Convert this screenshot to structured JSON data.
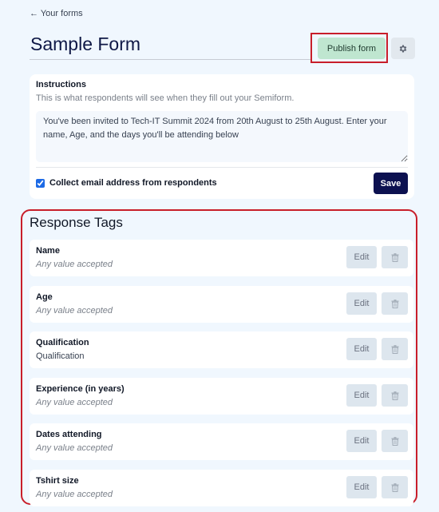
{
  "nav": {
    "back_link": "← Your forms"
  },
  "header": {
    "title": "Sample Form",
    "publish_label": "Publish form",
    "settings_icon": "gear-icon"
  },
  "instructions": {
    "label": "Instructions",
    "help_text": "This is what respondents will see when they fill out your Semiform.",
    "value": "You've been invited to Tech-IT Summit 2024 from 20th August to 25th August. Enter your name, Age, and the days you'll be attending below",
    "collect_email_label": "Collect email address from respondents",
    "collect_email_checked": true,
    "save_label": "Save"
  },
  "response_tags": {
    "title": "Response Tags",
    "edit_label": "Edit",
    "delete_icon": "trash-icon",
    "items": [
      {
        "name": "Name",
        "description": "Any value accepted",
        "placeholder_style": true
      },
      {
        "name": "Age",
        "description": "Any value accepted",
        "placeholder_style": true
      },
      {
        "name": "Qualification",
        "description": "Qualification",
        "placeholder_style": false
      },
      {
        "name": "Experience (in years)",
        "description": "Any value accepted",
        "placeholder_style": true
      },
      {
        "name": "Dates attending",
        "description": "Any value accepted",
        "placeholder_style": true
      },
      {
        "name": "Tshirt size",
        "description": "Any value accepted",
        "placeholder_style": true
      }
    ]
  },
  "colors": {
    "background": "#f0f7fe",
    "title": "#0f1846",
    "publish_bg": "#bfe6d0",
    "save_bg": "#0c1150",
    "highlight": "#c81e2a",
    "secondary_btn_bg": "#dde6ee"
  }
}
